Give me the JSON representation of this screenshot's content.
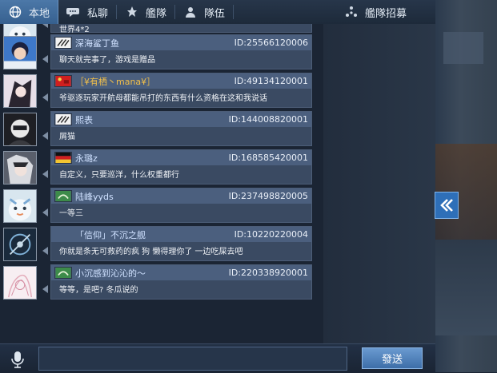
{
  "tabs": [
    {
      "label": "本地",
      "icon": "globe-icon"
    },
    {
      "label": "私聊",
      "icon": "chat-bubble-icon"
    },
    {
      "label": "艦隊",
      "icon": "fleet-icon"
    },
    {
      "label": "隊伍",
      "icon": "team-icon"
    },
    {
      "label": "艦隊招募",
      "icon": "recruit-icon"
    }
  ],
  "partial_message": {
    "text": "世界4*2"
  },
  "messages": [
    {
      "name": "深海鲨丁鱼",
      "id": "ID:25566120006",
      "text": "聊天就完事了，游戏是赠品"
    },
    {
      "name": "［¥有栖丶mana¥］",
      "id": "ID:49134120001",
      "text": "爷驱逐玩家开航母都能吊打的东西有什么资格在这和我说话"
    },
    {
      "name": "熙表",
      "id": "ID:144008820001",
      "text": "屑猫"
    },
    {
      "name": "永璐z",
      "id": "ID:168585420001",
      "text": "自定义，只要巡洋，什么权重都行"
    },
    {
      "name": "陆峰yyds",
      "id": "ID:237498820005",
      "text": "一等三"
    },
    {
      "name": "「信仰」不沉之舰",
      "id": "ID:10220220004",
      "text": "你就是条无可救药的疯 狗 懒得理你了 一边吃屎去吧"
    },
    {
      "name": "小沉感到沁沁的～",
      "id": "ID:220338920001",
      "text": "等等，是吧? 冬瓜说的"
    }
  ],
  "input": {
    "value": "",
    "placeholder": ""
  },
  "send_label": "發送",
  "colors": {
    "accent": "#3d6ea8",
    "tab_active": "#4c78a8",
    "bubble": "#3a4a62",
    "name_text": "#cfe1ff"
  }
}
